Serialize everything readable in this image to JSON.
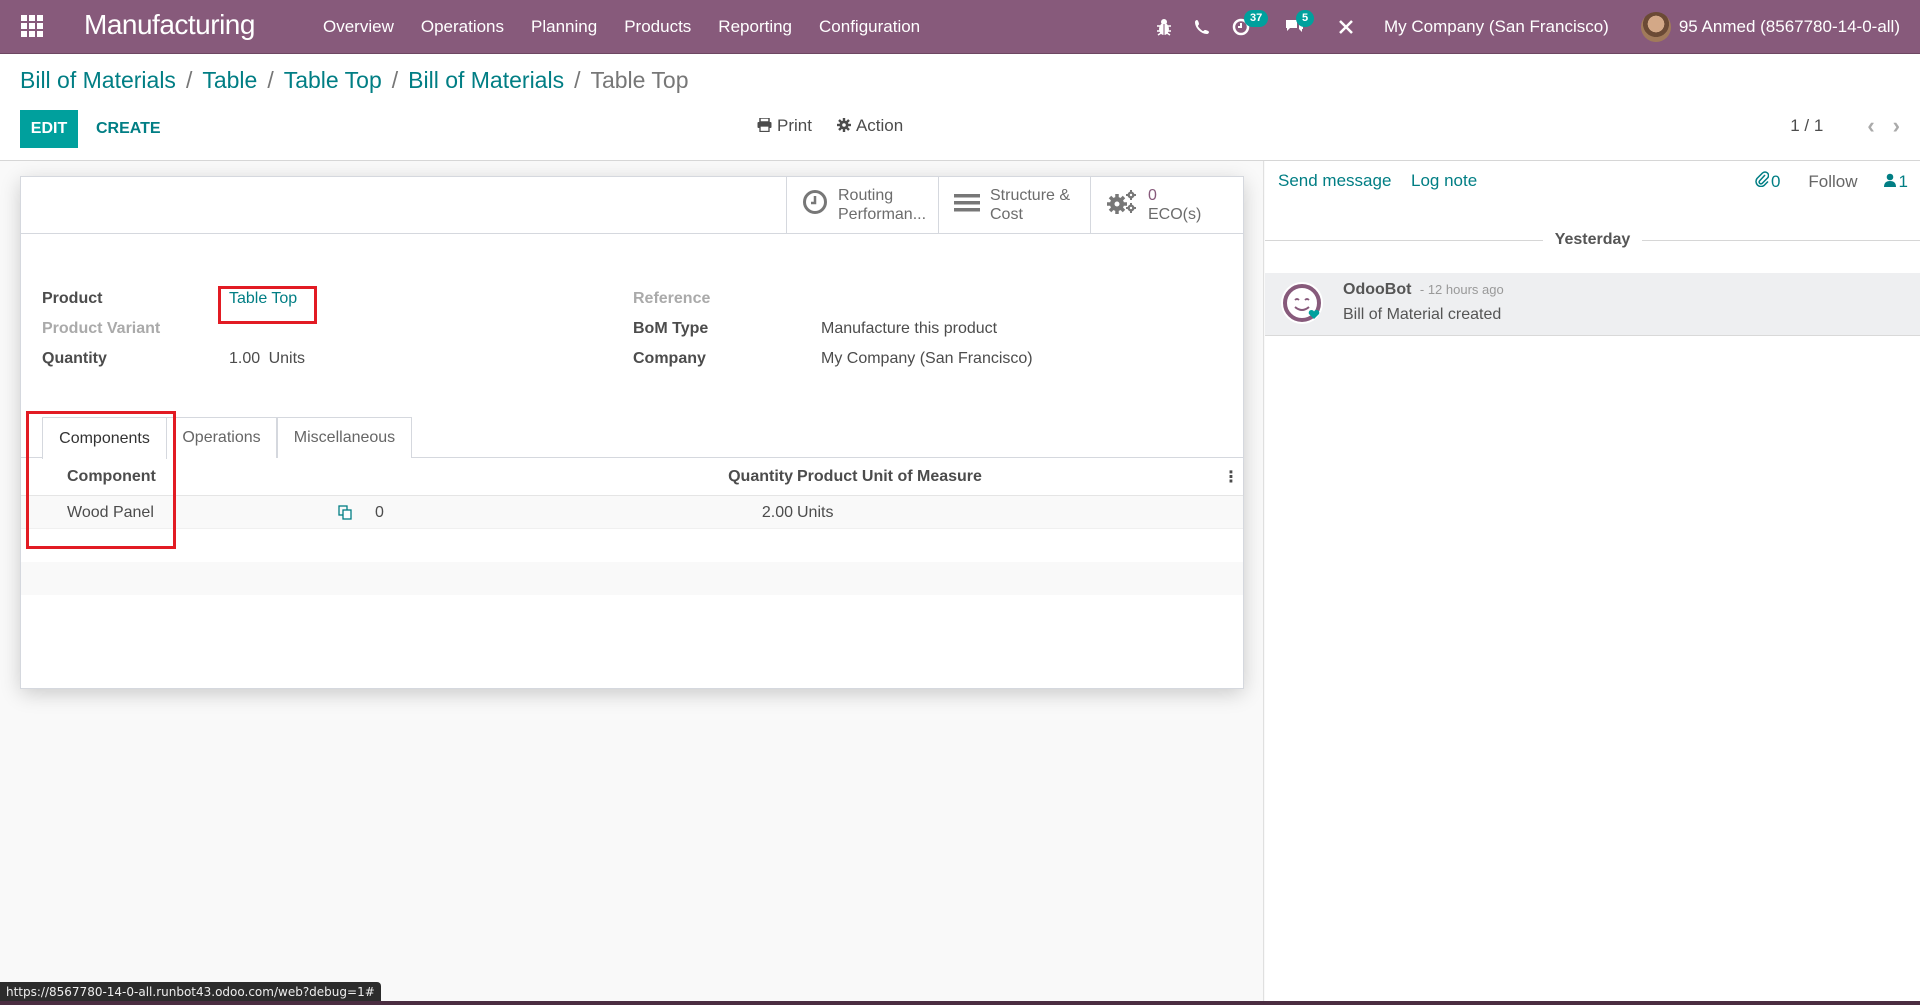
{
  "navbar": {
    "app_name": "Manufacturing",
    "menu": [
      "Overview",
      "Operations",
      "Planning",
      "Products",
      "Reporting",
      "Configuration"
    ],
    "activities_count": "37",
    "messages_count": "5",
    "company": "My Company (San Francisco)",
    "user": "95 Anmed (8567780-14-0-all)",
    "brand_color": "#875A7B"
  },
  "breadcrumb": {
    "items": [
      "Bill of Materials",
      "Table",
      "Table Top",
      "Bill of Materials"
    ],
    "separator": "/",
    "current": "Table Top"
  },
  "control_panel": {
    "edit_label": "EDIT",
    "create_label": "CREATE",
    "print_label": "Print",
    "action_label": "Action",
    "pager": "1 / 1"
  },
  "button_box": {
    "routing": "Routing Performan...",
    "routing_l1": "Routing",
    "routing_l2": "Performan...",
    "structure_l1": "Structure &",
    "structure_l2": "Cost",
    "eco_value": "0",
    "eco_label": "ECO(s)"
  },
  "form": {
    "product_label": "Product",
    "product_value": "Table Top",
    "variant_label": "Product Variant",
    "variant_value": "",
    "quantity_label": "Quantity",
    "quantity_value": "1.00",
    "quantity_uom": "Units",
    "reference_label": "Reference",
    "reference_value": "",
    "bom_type_label": "BoM Type",
    "bom_type_value": "Manufacture this product",
    "company_label": "Company",
    "company_value": "My Company (San Francisco)"
  },
  "tabs": [
    "Components",
    "Operations",
    "Miscellaneous"
  ],
  "active_tab": "Components",
  "components_table": {
    "headers": [
      "Component",
      "Quantity",
      "Product Unit of Measure"
    ],
    "rows": [
      {
        "component": "Wood Panel",
        "variant_count": "0",
        "quantity": "2.00",
        "uom": "Units"
      }
    ]
  },
  "chatter": {
    "send_message": "Send message",
    "log_note": "Log note",
    "attachments": "0",
    "follow": "Follow",
    "followers": "1",
    "date_separator": "Yesterday",
    "messages": [
      {
        "author": "OdooBot",
        "date": "- 12 hours ago",
        "body": "Bill of Material created"
      }
    ]
  },
  "status_bar_url": "https://8567780-14-0-all.runbot43.odoo.com/web?debug=1#"
}
